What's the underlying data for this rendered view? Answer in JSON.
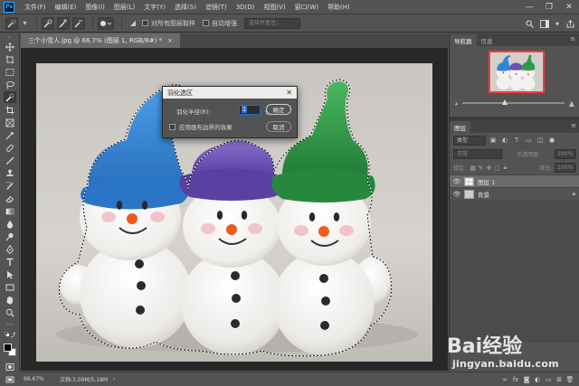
{
  "app": {
    "logo": "Ps"
  },
  "menu": [
    "文件(F)",
    "编辑(E)",
    "图像(I)",
    "图层(L)",
    "文字(Y)",
    "选择(S)",
    "滤镜(T)",
    "3D(D)",
    "视图(V)",
    "窗口(W)",
    "帮助(H)"
  ],
  "window_controls": {
    "minimize": "—",
    "restore": "❐",
    "close": "✕"
  },
  "options_bar": {
    "sample_all_layers": "对所有图层取样",
    "auto_enhance": "自动增强",
    "select_subject": "选择并遮住..."
  },
  "document": {
    "tab_title": "三个小雪人.jpg @ 66.7% (图层 1, RGB/8#) *",
    "tab_close": "×"
  },
  "status": {
    "zoom": "66.67%",
    "doc_info": "文档:3.09M/5.18M",
    "arrow": "›"
  },
  "navigator": {
    "tabs": [
      "导航器",
      "信息"
    ],
    "zoom_value_fraction": 0.42
  },
  "layers": {
    "tabs": [
      "图层"
    ],
    "kind": "类型",
    "blend_mode": "正常",
    "opacity_label": "不透明度:",
    "opacity_value": "100%",
    "lock_label": "锁定:",
    "fill_label": "填充:",
    "fill_value": "100%",
    "items": [
      {
        "name": "图层 1",
        "selected": true
      },
      {
        "name": "背景",
        "selected": false
      }
    ]
  },
  "dialog": {
    "title": "羽化选区",
    "radius_label": "羽化半径(R):",
    "radius_value": "1",
    "unit": "像素",
    "checkbox_label": "应用画布边界的效果",
    "ok": "确定",
    "cancel": "取消",
    "close": "✕"
  },
  "watermark": {
    "brand": "Bai经验",
    "url": "jingyan.baidu.com"
  },
  "colors": {
    "hat_blue": "#2f84d6",
    "hat_purple": "#6b50b5",
    "hat_green": "#2f9a45",
    "nav_frame": "#ff3b3b"
  }
}
